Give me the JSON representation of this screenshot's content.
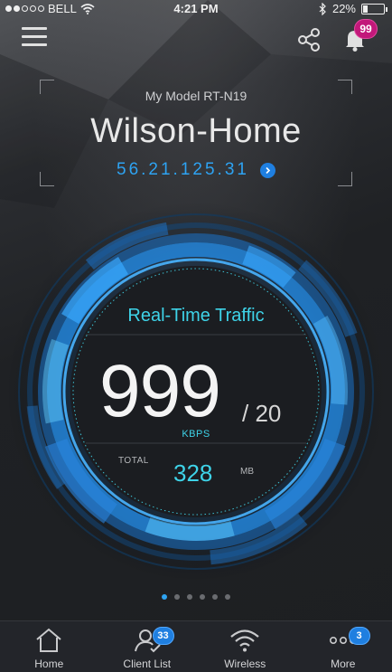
{
  "status_bar": {
    "carrier": "BELL",
    "time": "4:21 PM",
    "battery": "22%",
    "battery_level": 0.22,
    "icons": [
      "signal-dots-icon",
      "wifi-icon",
      "bluetooth-icon",
      "battery-icon"
    ]
  },
  "header": {
    "menu_icon": "hamburger-menu-icon",
    "share_icon": "share-icon",
    "bell_icon": "bell-icon",
    "notification_count": "99"
  },
  "router": {
    "model": "My Model RT-N19",
    "name": "Wilson-Home",
    "ip": "56.21.125.31",
    "ip_arrow_icon": "chevron-right-icon"
  },
  "traffic": {
    "title": "Real-Time Traffic",
    "current": "999",
    "max": "/ 20",
    "unit": "KBPS",
    "total_label": "TOTAL",
    "total_value": "328",
    "total_unit": "MB"
  },
  "pager": {
    "count": 6,
    "active_index": 0
  },
  "tabs": [
    {
      "label": "Home",
      "icon": "home-icon",
      "badge": ""
    },
    {
      "label": "Client List",
      "icon": "client-list-icon",
      "badge": "33"
    },
    {
      "label": "Wireless",
      "icon": "wifi-icon",
      "badge": ""
    },
    {
      "label": "More",
      "icon": "more-icon",
      "badge": "3"
    }
  ],
  "colors": {
    "accent": "#2ea3f2",
    "cyan": "#3ed3e8",
    "notification": "#c2187a",
    "badge": "#1f7fe0"
  }
}
